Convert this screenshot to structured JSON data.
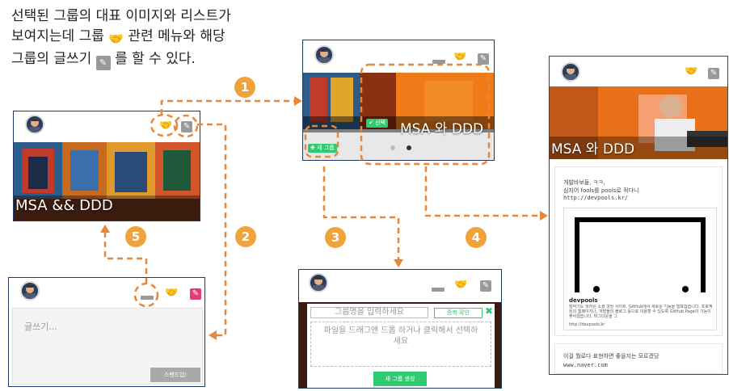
{
  "intro": {
    "line1": "선택된 그룹의 대표 이미지와 리스트가",
    "line2a": "보여지는데 그룹",
    "line2b": "관련 메뉴와 해당",
    "line3a": "그룹의 글쓰기",
    "line3b": "를 할 수 있다."
  },
  "steps": [
    "1",
    "2",
    "3",
    "4",
    "5"
  ],
  "panel_group": {
    "title": "MSA && DDD"
  },
  "panel_select": {
    "title": "MSA 와 DDD",
    "select_btn": "✔ 선택",
    "new_group_btn": "✚ 새 그룹"
  },
  "panel_write": {
    "placeholder": "글쓰기...",
    "submit": "스펜드업!"
  },
  "panel_create": {
    "name_placeholder": "그룹명을 입력하세요",
    "check_btn": "중복 확인",
    "close": "✖",
    "drop_text": "파일을 드래그앤 드롭 하거나 클릭해서 선택하세요",
    "create_btn": "새 그룹 생성"
  },
  "panel_post": {
    "title": "MSA 와 DDD",
    "text1": "개발바보들, ㅋㅋ,",
    "text2": "심지어 fools를 pools로 적다니",
    "url": "http://devpools.kr/",
    "card_title": "devpools",
    "card_desc": "말하기도 잊어픈 소셜 코딩 사이트. GitHub에서 새로운 기능을 발표합습니다. 프로젝트의 웹페이지나, 개발들의 블로그 등으로 이용할 수 있도록 GitHub Page의 기능이 좋아졌습니다. 머그다운을 그",
    "card_url": "http://devpools.kr",
    "text3": "이걸 뭘로다 표현하면 좋을지는 모르겠당",
    "text4": "www.naver.com"
  },
  "colors": {
    "arrow": "#e8873a",
    "step": "#f0a23b",
    "pink": "#e8397a",
    "green": "#2ecc71"
  }
}
